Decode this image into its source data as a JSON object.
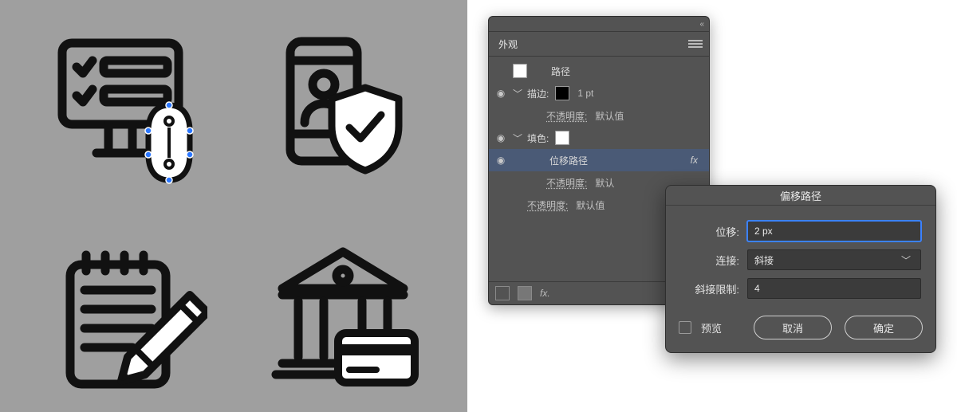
{
  "panel": {
    "collapse_hint": "«",
    "tab": "外观",
    "row_path": "路径",
    "stroke_label": "描边:",
    "stroke_weight": "1 pt",
    "fill_label": "填色:",
    "offset_effect": "位移路径",
    "fx_label": "fx",
    "opacity_label": "不透明度:",
    "opacity_value_default": "默认值",
    "opacity_value_trunc": "默认",
    "footer_fx": "fx."
  },
  "dialog": {
    "title": "偏移路径",
    "offset_label": "位移:",
    "offset_value": "2 px",
    "join_label": "连接:",
    "join_value": "斜接",
    "miter_label": "斜接限制:",
    "miter_value": "4",
    "preview_label": "预览",
    "cancel": "取消",
    "ok": "确定"
  },
  "icons": {
    "monitor": "monitor-checklist-icon",
    "mouse": "mouse-icon",
    "phone": "phone-profile-icon",
    "shield": "shield-check-icon",
    "note": "notepad-pencil-icon",
    "bank": "bank-card-icon"
  }
}
